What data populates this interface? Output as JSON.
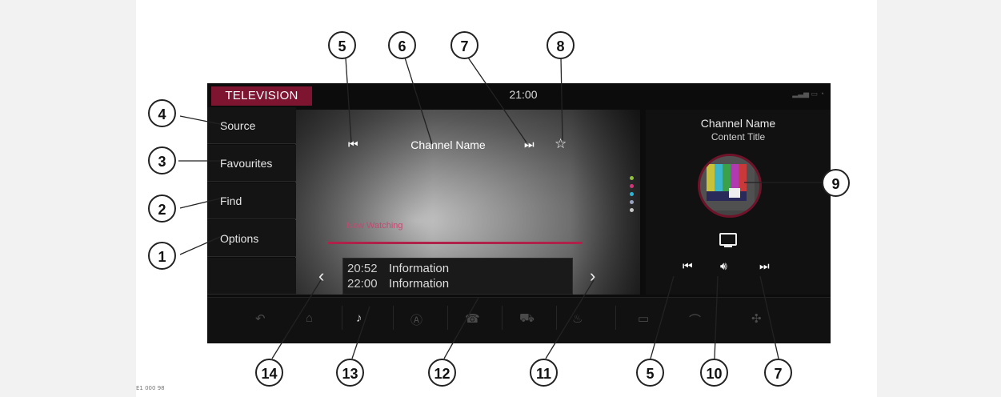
{
  "figure_id": "E1 000 98",
  "screen": {
    "tab_title": "TELEVISION",
    "clock": "21:00",
    "menu": [
      {
        "label": "Source"
      },
      {
        "label": "Favourites"
      },
      {
        "label": "Find"
      },
      {
        "label": "Options"
      }
    ],
    "player": {
      "channel_name": "Channel Name",
      "now_watching": "Now Watching",
      "schedule": [
        {
          "time": "20:52",
          "info": "Information"
        },
        {
          "time": "22:00",
          "info": "Information"
        }
      ]
    },
    "right_panel": {
      "channel_name": "Channel Name",
      "content_title": "Content Title"
    },
    "colors": {
      "accent": "#7d1430",
      "progress": "#b0224a",
      "dot_colors": [
        "#8fc23a",
        "#d8337a",
        "#2ab6d9",
        "#9aa3c4",
        "#c9c9c9"
      ]
    },
    "icons": {
      "previous": "skip-previous-icon",
      "next": "skip-next-icon",
      "favourite": "star-icon",
      "tv": "tv-icon",
      "volume": "speaker-icon",
      "chevron_left": "chevron-left-icon",
      "chevron_right": "chevron-right-icon"
    }
  },
  "callouts": {
    "c1": "1",
    "c2": "2",
    "c3": "3",
    "c4": "4",
    "c5": "5",
    "c6": "6",
    "c7": "7",
    "c8": "8",
    "c9": "9",
    "c10": "10",
    "c11": "11",
    "c12": "12",
    "c13": "13",
    "c14": "14"
  }
}
